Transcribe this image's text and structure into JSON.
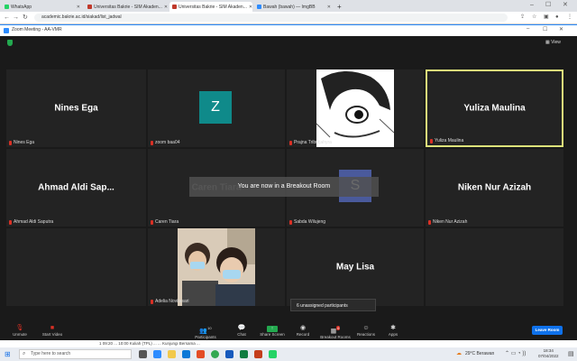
{
  "browser": {
    "tabs": [
      {
        "label": "WhatsApp",
        "color": "#25d366",
        "active": false
      },
      {
        "label": "Universitas Bakrie - SIM Akaden...",
        "color": "#c0392b",
        "active": false
      },
      {
        "label": "Universitas Bakrie - SIM Akaden...",
        "color": "#c0392b",
        "active": true
      },
      {
        "label": "Bawah (bawah) — ImgBB",
        "color": "#2d8cff",
        "active": false
      }
    ],
    "new_tab": "+",
    "url": "academic.bakrie.ac.id/siakad/list_jadwal"
  },
  "zoom": {
    "window_title": "Zoom Meeting - AA-VMR",
    "view_label": "View",
    "breakout_notice": "You are now in a Breakout Room",
    "unassigned": "6 unassigned participants",
    "tiles": [
      {
        "name": "Nines Ega",
        "label": "Nines Ega",
        "kind": "name"
      },
      {
        "name": "Z",
        "label": "zoom baa04",
        "kind": "avatar",
        "color": "#0f8a8a"
      },
      {
        "name": "",
        "label": "Prajna Tributjahyra",
        "kind": "manga"
      },
      {
        "name": "Yuliza Maulina",
        "label": "Yuliza Maulina",
        "kind": "name",
        "active": true
      },
      {
        "name": "Ahmad Aldi Sap...",
        "label": "Ahmad Aldi Saputra",
        "kind": "name"
      },
      {
        "name": "Caren Tiara",
        "label": "Caren Tiara",
        "kind": "dim"
      },
      {
        "name": "S",
        "label": "Sabda Wilujeng",
        "kind": "avatar",
        "color": "#4a5a9c"
      },
      {
        "name": "Niken Nur Azizah",
        "label": "Niken Nur Azizah",
        "kind": "name"
      },
      {
        "name": "",
        "label": "",
        "kind": "empty"
      },
      {
        "name": "",
        "label": "Adelia Novitasari",
        "kind": "photo"
      },
      {
        "name": "May Lisa",
        "label": "",
        "kind": "name"
      },
      {
        "name": "",
        "label": "",
        "kind": "empty"
      }
    ],
    "toolbar": {
      "unmute": "Unmute",
      "start_video": "Start Video",
      "participants": "Participants",
      "participants_count": "10",
      "chat": "Chat",
      "share_screen": "Share Screen",
      "record": "Record",
      "breakout_rooms": "Breakout Rooms",
      "breakout_badge": "6",
      "reactions": "Reactions",
      "apps": "Apps",
      "leave": "Leave Room"
    }
  },
  "peek_row": "1   09:20 ... 10:00    Kuliah   (TPL)   ...   ...   Kunjungi Bersama   ...",
  "taskbar": {
    "search_placeholder": "Type here to search",
    "weather": "29°C  Berawan",
    "time": "18:34",
    "date": "07/04/2022"
  }
}
